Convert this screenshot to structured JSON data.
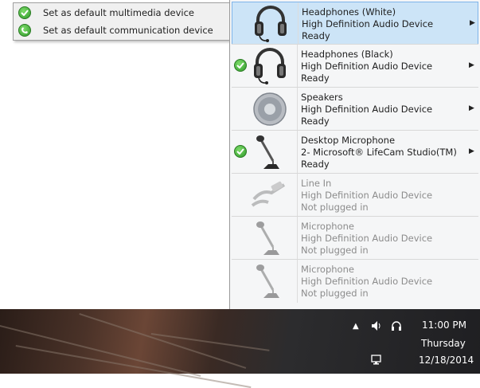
{
  "context_menu": {
    "items": [
      {
        "label": "Set as default multimedia device",
        "icon": "green-check-icon"
      },
      {
        "label": "Set as default communication device",
        "icon": "green-phone-icon"
      }
    ]
  },
  "devices": [
    {
      "name": "Headphones (White)",
      "driver": "High Definition Audio Device",
      "status": "Ready",
      "icon": "headphones-icon",
      "default": false,
      "selected": true,
      "available": true
    },
    {
      "name": "Headphones (Black)",
      "driver": "High Definition Audio Device",
      "status": "Ready",
      "icon": "headphones-icon",
      "default": true,
      "selected": false,
      "available": true
    },
    {
      "name": "Speakers",
      "driver": "High Definition Audio Device",
      "status": "Ready",
      "icon": "speaker-icon",
      "default": false,
      "selected": false,
      "available": true
    },
    {
      "name": "Desktop Microphone",
      "driver": "2- Microsoft® LifeCam Studio(TM)",
      "status": "Ready",
      "icon": "microphone-icon",
      "default": true,
      "selected": false,
      "available": true
    },
    {
      "name": "Line In",
      "driver": "High Definition Audio Device",
      "status": "Not plugged in",
      "icon": "line-in-cable-icon",
      "default": false,
      "selected": false,
      "available": false
    },
    {
      "name": "Microphone",
      "driver": "High Definition Audio Device",
      "status": "Not plugged in",
      "icon": "microphone-icon",
      "default": false,
      "selected": false,
      "available": false
    },
    {
      "name": "Microphone",
      "driver": "High Definition Audio Device",
      "status": "Not plugged in",
      "icon": "microphone-icon",
      "default": false,
      "selected": false,
      "available": false
    }
  ],
  "taskbar": {
    "time": "11:00 PM",
    "day": "Thursday",
    "date": "12/18/2014",
    "tray_icons": [
      "show-hidden-icons-arrow",
      "volume-icon",
      "headset-icon",
      "network-icon"
    ]
  },
  "colors": {
    "selection": "#cce4f7",
    "selection_border": "#7eb4ea",
    "check_green": "#2f9a2a",
    "disabled_text": "#8c8c8c"
  }
}
